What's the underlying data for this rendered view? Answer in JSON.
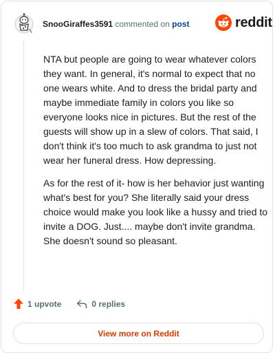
{
  "comment": {
    "username": "SnooGiraffes3591",
    "action_text": "commented on",
    "post_link_label": "post",
    "paragraphs": [
      "NTA but people are going to wear whatever colors they want. In general, it's normal to expect that no one wears white. And to dress the bridal party and maybe immediate family in colors you like so everyone looks nice in pictures. But the rest of the guests will show up in a slew of colors. That said, I don't think it's too much to ask grandma to just not wear her funeral dress. How depressing.",
      "As for the rest of it- how is her behavior just wanting what's best for you? She literally said your dress choice would make you look like a hussy and tried to invite a DOG. Just.... maybe don't invite grandma. She doesn't sound so pleasant."
    ],
    "upvote_label": "1 upvote",
    "replies_label": "0 replies"
  },
  "brand": {
    "wordmark": "reddit",
    "accent_color": "#ff4500"
  },
  "view_more_label": "View more on Reddit",
  "icons": {
    "avatar": "snoo-avatar",
    "upvote": "upvote-arrow-icon",
    "reply": "reply-icon",
    "logo": "reddit-snoo-icon"
  }
}
